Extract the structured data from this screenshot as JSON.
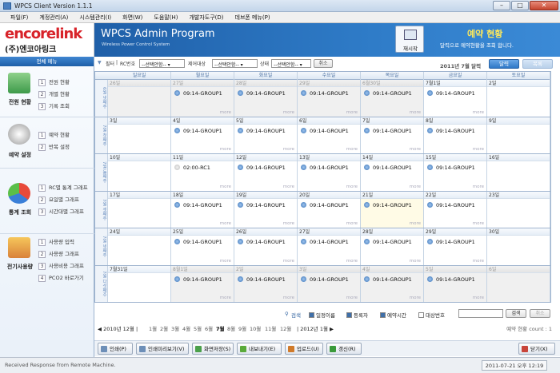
{
  "window": {
    "title": "WPCS Client Version 1.1.1"
  },
  "menu": [
    "파일(F)",
    "계정관리(A)",
    "시스템관리(I)",
    "화면(W)",
    "도움말(H)",
    "개발자도구(D)",
    "데브폰 메뉴(P)"
  ],
  "logo": {
    "brand": "encorelink",
    "brand_kr": "(주)엔코아링크"
  },
  "header": {
    "title": "WPCS Admin Program",
    "subtitle": "Wireless Power Control System",
    "refresh_label": "재시작",
    "page_heading": "예약 현황",
    "page_desc": "달력으로 예약현황을 조회 합니다."
  },
  "sidebar": {
    "head": "전체 메뉴",
    "groups": [
      {
        "name": "전원 현황",
        "items": [
          {
            "n": "1",
            "label": "전원 현황"
          },
          {
            "n": "2",
            "label": "개별 현황"
          },
          {
            "n": "3",
            "label": "기록 조회"
          }
        ]
      },
      {
        "name": "예약 설정",
        "items": [
          {
            "n": "1",
            "label": "예약 현황"
          },
          {
            "n": "2",
            "label": "반복 설정"
          }
        ]
      },
      {
        "name": "통계 조회",
        "items": [
          {
            "n": "1",
            "label": "RC별 통계 그래프"
          },
          {
            "n": "2",
            "label": "요일별 그래프"
          },
          {
            "n": "3",
            "label": "시간대별 그래프"
          }
        ]
      },
      {
        "name": "전기사용량",
        "items": [
          {
            "n": "1",
            "label": "사용량 입력"
          },
          {
            "n": "2",
            "label": "사용량 그래프"
          },
          {
            "n": "3",
            "label": "사용비용 그래프"
          },
          {
            "n": "4",
            "label": "PCO2 바로가기"
          }
        ]
      }
    ]
  },
  "filter": {
    "filter_label": "필터",
    "rc_label": "RC번호",
    "rc_value": "--선택안함--",
    "target_label": "제어대상",
    "target_value": "--선택안함--",
    "state_label": "상태",
    "state_value": "--선택안함--",
    "cancel_label": "취소",
    "month_label": "2011년 7월 달력",
    "calendar_btn": "달력",
    "list_btn": "목록"
  },
  "calendar": {
    "dow": [
      "일요일",
      "월요일",
      "화요일",
      "수요일",
      "목요일",
      "금요일",
      "토요일"
    ],
    "more_label": "more",
    "weeks": [
      {
        "label": "6월 넷째주",
        "days": [
          {
            "d": "26일",
            "other": true,
            "ev": ""
          },
          {
            "d": "27일",
            "other": true,
            "ev": "09:14-GROUP1"
          },
          {
            "d": "28일",
            "other": true,
            "ev": "09:14-GROUP1"
          },
          {
            "d": "29일",
            "other": true,
            "ev": "09:14-GROUP1"
          },
          {
            "d": "6월30일",
            "other": true,
            "ev": "09:14-GROUP1"
          },
          {
            "d": "7월1일",
            "other": false,
            "ev": "09:14-GROUP1"
          },
          {
            "d": "2일",
            "other": false,
            "ev": ""
          }
        ]
      },
      {
        "label": "7월 첫째주",
        "days": [
          {
            "d": "3일",
            "other": false,
            "ev": ""
          },
          {
            "d": "4일",
            "other": false,
            "ev": "09:14-GROUP1"
          },
          {
            "d": "5일",
            "other": false,
            "ev": "09:14-GROUP1"
          },
          {
            "d": "6일",
            "other": false,
            "ev": "09:14-GROUP1"
          },
          {
            "d": "7일",
            "other": false,
            "ev": "09:14-GROUP1"
          },
          {
            "d": "8일",
            "other": false,
            "ev": "09:14-GROUP1"
          },
          {
            "d": "9일",
            "other": false,
            "ev": ""
          }
        ]
      },
      {
        "label": "7월 둘째주",
        "days": [
          {
            "d": "10일",
            "other": false,
            "ev": ""
          },
          {
            "d": "11일",
            "other": false,
            "ev": "02:00-RC1",
            "grey": true
          },
          {
            "d": "12일",
            "other": false,
            "ev": "09:14-GROUP1"
          },
          {
            "d": "13일",
            "other": false,
            "ev": "09:14-GROUP1"
          },
          {
            "d": "14일",
            "other": false,
            "ev": "09:14-GROUP1"
          },
          {
            "d": "15일",
            "other": false,
            "ev": "09:14-GROUP1"
          },
          {
            "d": "16일",
            "other": false,
            "ev": ""
          }
        ]
      },
      {
        "label": "7월 셋째주",
        "days": [
          {
            "d": "17일",
            "other": false,
            "ev": ""
          },
          {
            "d": "18일",
            "other": false,
            "ev": "09:14-GROUP1"
          },
          {
            "d": "19일",
            "other": false,
            "ev": "09:14-GROUP1"
          },
          {
            "d": "20일",
            "other": false,
            "ev": "09:14-GROUP1"
          },
          {
            "d": "21일",
            "other": false,
            "ev": "09:14-GROUP1",
            "today": true
          },
          {
            "d": "22일",
            "other": false,
            "ev": "09:14-GROUP1"
          },
          {
            "d": "23일",
            "other": false,
            "ev": ""
          }
        ]
      },
      {
        "label": "7월 넷째주",
        "days": [
          {
            "d": "24일",
            "other": false,
            "ev": ""
          },
          {
            "d": "25일",
            "other": false,
            "ev": "09:14-GROUP1"
          },
          {
            "d": "26일",
            "other": false,
            "ev": "09:14-GROUP1"
          },
          {
            "d": "27일",
            "other": false,
            "ev": "09:14-GROUP1"
          },
          {
            "d": "28일",
            "other": false,
            "ev": "09:14-GROUP1"
          },
          {
            "d": "29일",
            "other": false,
            "ev": "09:14-GROUP1"
          },
          {
            "d": "30일",
            "other": false,
            "ev": ""
          }
        ]
      },
      {
        "label": "7월 다섯째주",
        "days": [
          {
            "d": "7월31일",
            "other": false,
            "ev": ""
          },
          {
            "d": "8월1일",
            "other": true,
            "ev": "09:14-GROUP1"
          },
          {
            "d": "2일",
            "other": true,
            "ev": "09:14-GROUP1"
          },
          {
            "d": "3일",
            "other": true,
            "ev": "09:14-GROUP1"
          },
          {
            "d": "4일",
            "other": true,
            "ev": "09:14-GROUP1"
          },
          {
            "d": "5일",
            "other": true,
            "ev": "09:14-GROUP1"
          },
          {
            "d": "6일",
            "other": true,
            "ev": ""
          }
        ]
      }
    ]
  },
  "search": {
    "label": "검색",
    "options": [
      {
        "label": "일정이름",
        "on": true
      },
      {
        "label": "등록자",
        "on": true
      },
      {
        "label": "예약시간",
        "on": true
      },
      {
        "label": "대상번호",
        "on": false
      }
    ],
    "search_btn": "검색",
    "cancel_btn": "취소",
    "count_text": "예약 현황 count : 1"
  },
  "monthnav": {
    "prev_year": "◀ 2010년 12월 |",
    "months": [
      "1월",
      "2월",
      "3월",
      "4월",
      "5월",
      "6월",
      "7월",
      "8월",
      "9월",
      "10월",
      "11월",
      "12월"
    ],
    "current": "7월",
    "next_year": "| 2012년 1월 ▶"
  },
  "toolbar": {
    "print": "인쇄(P)",
    "preview": "인쇄미리보기(V)",
    "save_screen": "화면저장(S)",
    "export": "내보내기(E)",
    "upload": "업로드(U)",
    "renew": "갱신(R)",
    "close": "닫기(X)"
  },
  "status": {
    "text": "Received Response from Remote Machine.",
    "clock": "2011-07-21 오후 12:19"
  }
}
